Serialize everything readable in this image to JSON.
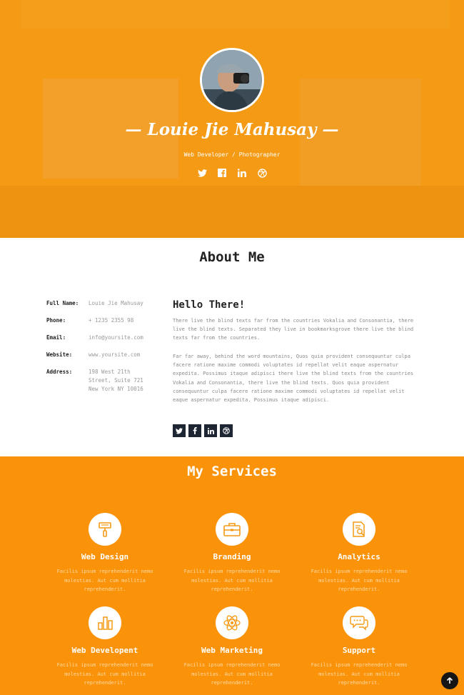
{
  "hero": {
    "name": "— Louie Jie Mahusay —",
    "role": "Web Developer / Photographer",
    "social": [
      "twitter-icon",
      "facebook-icon",
      "linkedin-icon",
      "dribbble-icon"
    ]
  },
  "about": {
    "title": "About Me",
    "info": [
      {
        "label": "Full Name:",
        "value": "Louie Jie Mahusay"
      },
      {
        "label": "Phone:",
        "value": "+ 1235 2355 98"
      },
      {
        "label": "Email:",
        "value": "info@yoursite.com"
      },
      {
        "label": "Website:",
        "value": "www.yoursite.com"
      },
      {
        "label": "Address:",
        "value": "198 West 21th Street, Suite 721 New York NY 10016"
      }
    ],
    "heading": "Hello There!",
    "paragraph1": "There live the blind texts far from the countries Vokalia and Consonantia, there live the blind texts. Separated they live in bookmarksgrove there live the blind texts far from the countries.",
    "paragraph2": "Far far away, behind the word mountains, Quos quia provident consequuntur culpa facere ratione maxime commodi voluptates id repellat velit eaque aspernatur expedita. Possimus itaque adipisci there live the blind texts from the countries Vokalia and Consonantia, there live the blind texts. Quos quia provident consequuntur culpa facere ratione maxime commodi voluptates id repellat velit eaque aspernatur expedita. Possimus itaque adipisci.",
    "social": [
      "twitter-icon",
      "facebook-icon",
      "linkedin-icon",
      "dribbble-icon"
    ]
  },
  "services": {
    "title": "My Services",
    "items": [
      {
        "title": "Web Design",
        "desc": "Facilis ipsum reprehenderit nemo molestias. Aut cum mollitia reprehenderit.",
        "icon": "paint-roller-icon"
      },
      {
        "title": "Branding",
        "desc": "Facilis ipsum reprehenderit nemo molestias. Aut cum mollitia reprehenderit.",
        "icon": "briefcase-icon"
      },
      {
        "title": "Analytics",
        "desc": "Facilis ipsum reprehenderit nemo molestias. Aut cum mollitia reprehenderit.",
        "icon": "document-search-icon"
      },
      {
        "title": "Web Developent",
        "desc": "Facilis ipsum reprehenderit nemo molestias. Aut cum mollitia reprehenderit.",
        "icon": "bar-chart-icon"
      },
      {
        "title": "Web Marketing",
        "desc": "Facilis ipsum reprehenderit nemo molestias. Aut cum mollitia reprehenderit.",
        "icon": "atom-icon"
      },
      {
        "title": "Support",
        "desc": "Facilis ipsum reprehenderit nemo molestias. Aut cum mollitia reprehenderit.",
        "icon": "chat-bubbles-icon"
      }
    ]
  },
  "colors": {
    "hero_orange": "#f49a14",
    "services_orange": "#fb930a",
    "dark_button": "#1f2633"
  }
}
